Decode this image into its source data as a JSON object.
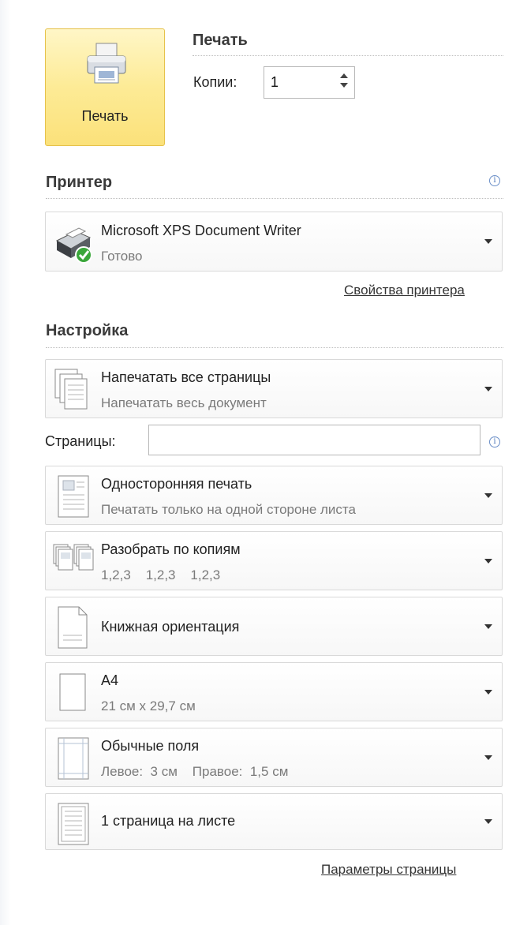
{
  "print": {
    "button_label": "Печать",
    "section_title": "Печать",
    "copies_label": "Копии:",
    "copies_value": "1"
  },
  "printer": {
    "section_title": "Принтер",
    "name": "Microsoft XPS Document Writer",
    "status": "Готово",
    "properties_link": "Свойства принтера"
  },
  "settings": {
    "section_title": "Настройка",
    "pages_label": "Страницы:",
    "pages_value": "",
    "options": [
      {
        "title": "Напечатать все страницы",
        "subtitle": "Напечатать весь документ"
      },
      {
        "title": "Односторонняя печать",
        "subtitle": "Печатать только на одной стороне листа"
      },
      {
        "title": "Разобрать по копиям",
        "subtitle": "1,2,3    1,2,3    1,2,3"
      },
      {
        "title": "Книжная ориентация"
      },
      {
        "title": "A4",
        "subtitle": "21 см x 29,7 см"
      },
      {
        "title": "Обычные поля",
        "subtitle": "Левое:  3 см    Правое:  1,5 см"
      },
      {
        "title": "1 страница на листе"
      }
    ],
    "page_setup_link": "Параметры страницы"
  },
  "icons": {
    "info": "info-icon",
    "printer": "printer-icon",
    "status_ok": "checkmark-icon"
  },
  "colors": {
    "print_button_fill": "#fdeb96",
    "print_button_border": "#e6c24a",
    "status_ok": "#3aa63a",
    "info": "#4a74b8"
  }
}
